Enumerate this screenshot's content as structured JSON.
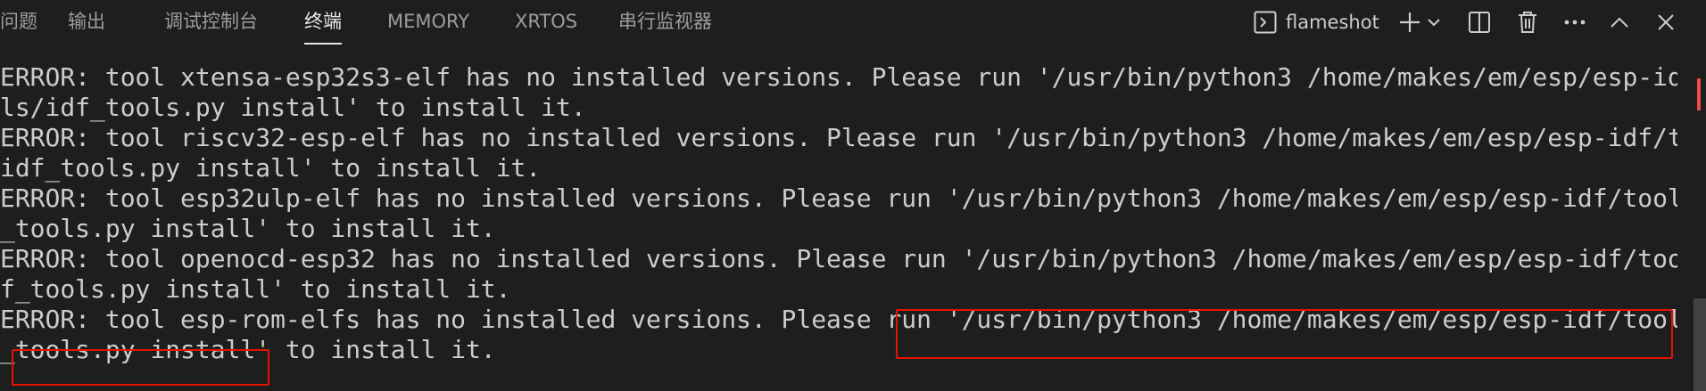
{
  "tabs": [
    {
      "label": "问题",
      "active": false
    },
    {
      "label": "输出",
      "active": false
    },
    {
      "label": "调试控制台",
      "active": false
    },
    {
      "label": "终端",
      "active": true
    },
    {
      "label": "MEMORY",
      "active": false
    },
    {
      "label": "XRTOS",
      "active": false
    },
    {
      "label": "串行监视器",
      "active": false
    }
  ],
  "terminal_header": {
    "terminal_name": "flameshot",
    "icons": [
      "terminal-icon",
      "plus-icon",
      "chevron-down-icon",
      "split-icon",
      "trash-icon",
      "ellipsis-icon",
      "chevron-up-icon",
      "close-icon"
    ]
  },
  "output_lines": [
    "ERROR: tool xtensa-esp32s3-elf has no installed versions. Please run '/usr/bin/python3 /home/makes/em/esp/esp-idf/too",
    "ls/idf_tools.py install' to install it.",
    "ERROR: tool riscv32-esp-elf has no installed versions. Please run '/usr/bin/python3 /home/makes/em/esp/esp-idf/tools/",
    "idf_tools.py install' to install it.",
    "ERROR: tool esp32ulp-elf has no installed versions. Please run '/usr/bin/python3 /home/makes/em/esp/esp-idf/tools/idf",
    "_tools.py install' to install it.",
    "ERROR: tool openocd-esp32 has no installed versions. Please run '/usr/bin/python3 /home/makes/em/esp/esp-idf/tools/id",
    "f_tools.py install' to install it.",
    "ERROR: tool esp-rom-elfs has no installed versions. Please run '/usr/bin/python3 /home/makes/em/esp/esp-idf/tools/idf",
    "_tools.py install' to install it."
  ],
  "colors": {
    "background": "#1e1e1e",
    "text": "#cccccc",
    "highlight_box": "#e51400",
    "scroll_marker": "#f14c4c"
  }
}
